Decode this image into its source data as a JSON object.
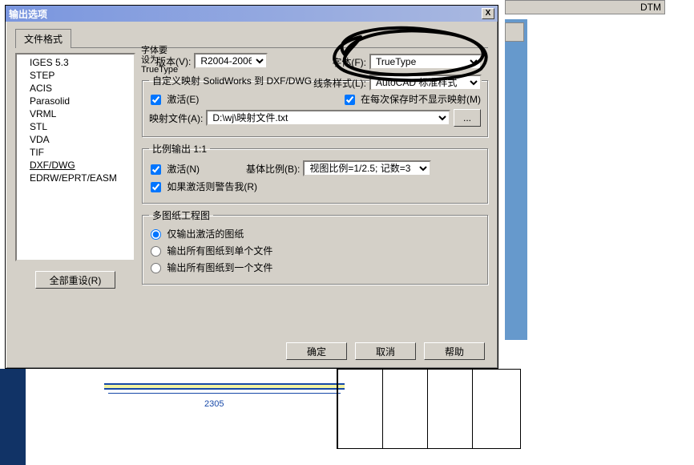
{
  "window": {
    "title": "输出选项",
    "close": "X"
  },
  "tab": {
    "label": "文件格式"
  },
  "annotation": "字体要设为TrueType",
  "formats": {
    "items": [
      "IGES 5.3",
      "STEP",
      "ACIS",
      "Parasolid",
      "VRML",
      "STL",
      "VDA",
      "TIF",
      "DXF/DWG",
      "EDRW/EPRT/EASM"
    ],
    "selected_index": 8
  },
  "reset_btn": "全部重设(R)",
  "version": {
    "label": "版本(V):",
    "value": "R2004-2006"
  },
  "font": {
    "label": "字体(F):",
    "value": "TrueType"
  },
  "linestyle": {
    "label": "线条样式(L):",
    "value": "AutoCAD 标准样式"
  },
  "mapping": {
    "legend": "自定义映射 SolidWorks 到 DXF/DWG",
    "active": "激活(E)",
    "active_checked": true,
    "suppress": "在每次保存时不显示映射(M)",
    "suppress_checked": true,
    "file_label": "映射文件(A):",
    "file_value": "D:\\wj\\映射文件.txt",
    "browse": "..."
  },
  "scale": {
    "legend": "比例输出 1:1",
    "active": "激活(N)",
    "active_checked": true,
    "base_label": "基体比例(B):",
    "base_value": "视图比例=1/2.5; 记数=3",
    "warn": "如果激活则警告我(R)",
    "warn_checked": true
  },
  "multi": {
    "legend": "多图纸工程图",
    "opt1": "仅输出激活的图纸",
    "opt2": "输出所有图纸到单个文件",
    "opt3": "输出所有图纸到一个文件",
    "selected": 0
  },
  "buttons": {
    "ok": "确定",
    "cancel": "取消",
    "help": "帮助"
  },
  "bg": {
    "dim_text": "2305",
    "toolbar_hint": "DTM"
  }
}
